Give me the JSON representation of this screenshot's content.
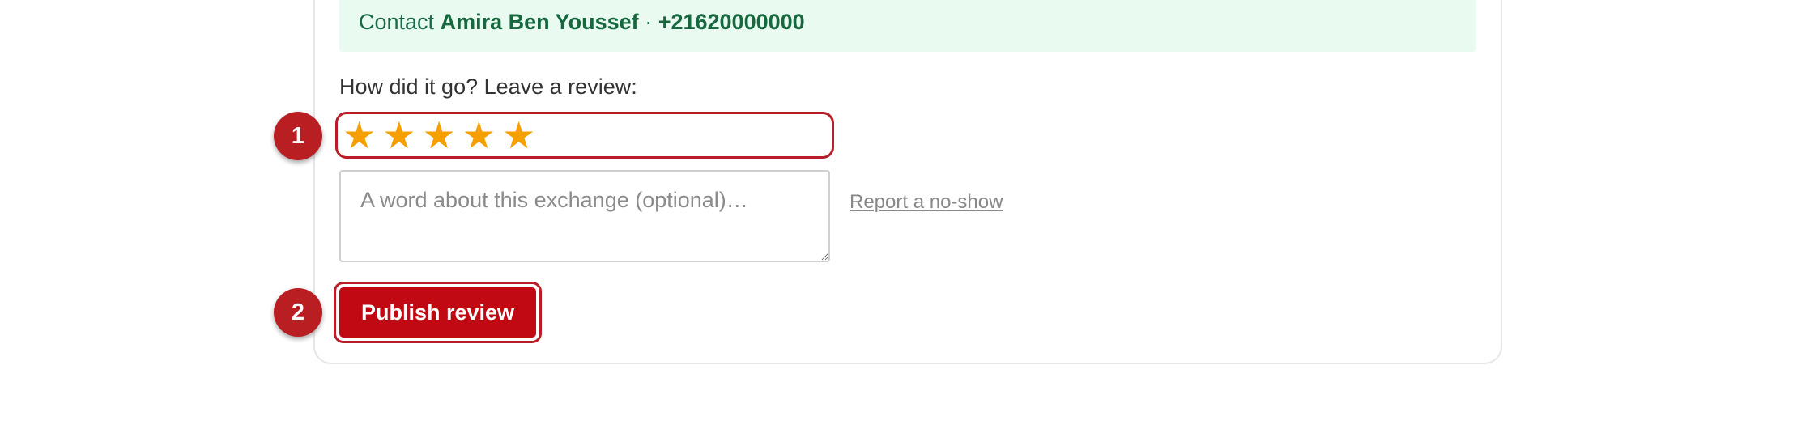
{
  "contact": {
    "prefix": "Contact",
    "name": "Amira Ben Youssef",
    "separator": "·",
    "phone": "+21620000000"
  },
  "review": {
    "prompt": "How did it go? Leave a review:",
    "rating": 5,
    "stars": [
      "★",
      "★",
      "★",
      "★",
      "★"
    ],
    "comment_placeholder": "A word about this exchange (optional)…",
    "comment_value": "",
    "report_link": "Report a no-show",
    "publish_label": "Publish review"
  },
  "annotations": {
    "badge_1": "1",
    "badge_2": "2"
  },
  "colors": {
    "accent_red": "#c00912",
    "highlight_red": "#b81e28",
    "star": "#f5a000",
    "contact_bg": "#e9fbf1",
    "contact_text": "#16683f"
  }
}
